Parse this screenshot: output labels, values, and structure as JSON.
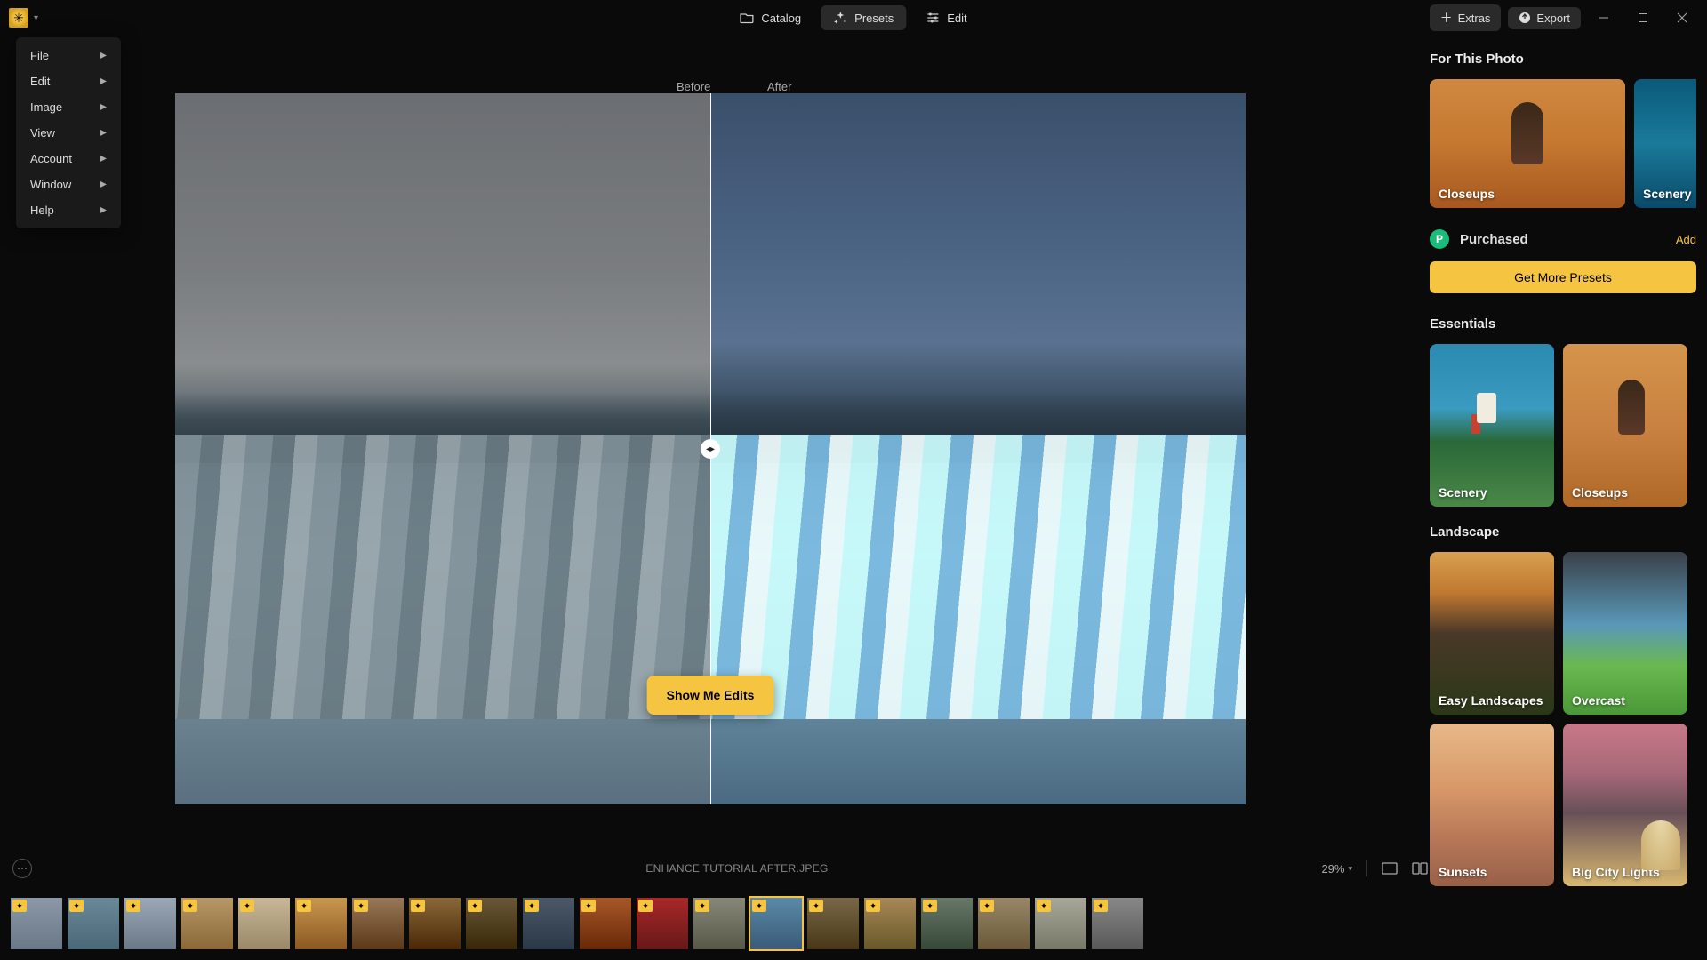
{
  "topbar": {
    "catalog": "Catalog",
    "presets": "Presets",
    "edit": "Edit",
    "extras": "Extras",
    "export": "Export"
  },
  "menu": [
    "File",
    "Edit",
    "Image",
    "View",
    "Account",
    "Window",
    "Help"
  ],
  "ba": {
    "before": "Before",
    "after": "After"
  },
  "edits_button": "Show Me Edits",
  "file_name": "ENHANCE TUTORIAL AFTER.JPEG",
  "zoom": "29%",
  "rpanel": {
    "for_this_photo": "For This Photo",
    "for_cards": [
      {
        "label": "Closeups"
      },
      {
        "label": "Scenery"
      }
    ],
    "purchased": "Purchased",
    "add": "Add",
    "get_more": "Get More Presets",
    "essentials": "Essentials",
    "essentials_cards": [
      {
        "label": "Scenery"
      },
      {
        "label": "Closeups"
      }
    ],
    "landscape": "Landscape",
    "landscape_cards": [
      {
        "label": "Easy Landscapes"
      },
      {
        "label": "Overcast"
      },
      {
        "label": "Sunsets"
      },
      {
        "label": "Big City Lights"
      }
    ]
  },
  "thumbs": {
    "count": 20,
    "selected_index": 13,
    "badged": [
      0,
      1,
      2,
      3,
      4,
      5,
      6,
      7,
      8,
      9,
      10,
      11,
      12,
      13,
      14,
      15,
      16,
      17,
      18,
      19
    ],
    "colors": [
      "linear-gradient(#8a98a8,#6a7888)",
      "linear-gradient(#6a8898,#4a6878)",
      "linear-gradient(#9aa8b8,#6a7888)",
      "linear-gradient(#b89868,#8a6838)",
      "linear-gradient(#c8b898,#9a8868)",
      "linear-gradient(#c89850,#8a5820)",
      "linear-gradient(#987858,#5a3818)",
      "linear-gradient(#8a6838,#4a2808)",
      "linear-gradient(#685838,#382808)",
      "linear-gradient(#4a5868,#2a3848)",
      "linear-gradient(#a85828,#682808)",
      "linear-gradient(#a82828,#681818)",
      "linear-gradient(#888878,#585848)",
      "linear-gradient(#5a8aa8,#3a5a78)",
      "linear-gradient(#786848,#483818)",
      "linear-gradient(#a88858,#685828)",
      "linear-gradient(#687868,#384838)",
      "linear-gradient(#988868,#685838)",
      "linear-gradient(#a8a898,#787868)",
      "linear-gradient(#888888,#585858)"
    ]
  }
}
